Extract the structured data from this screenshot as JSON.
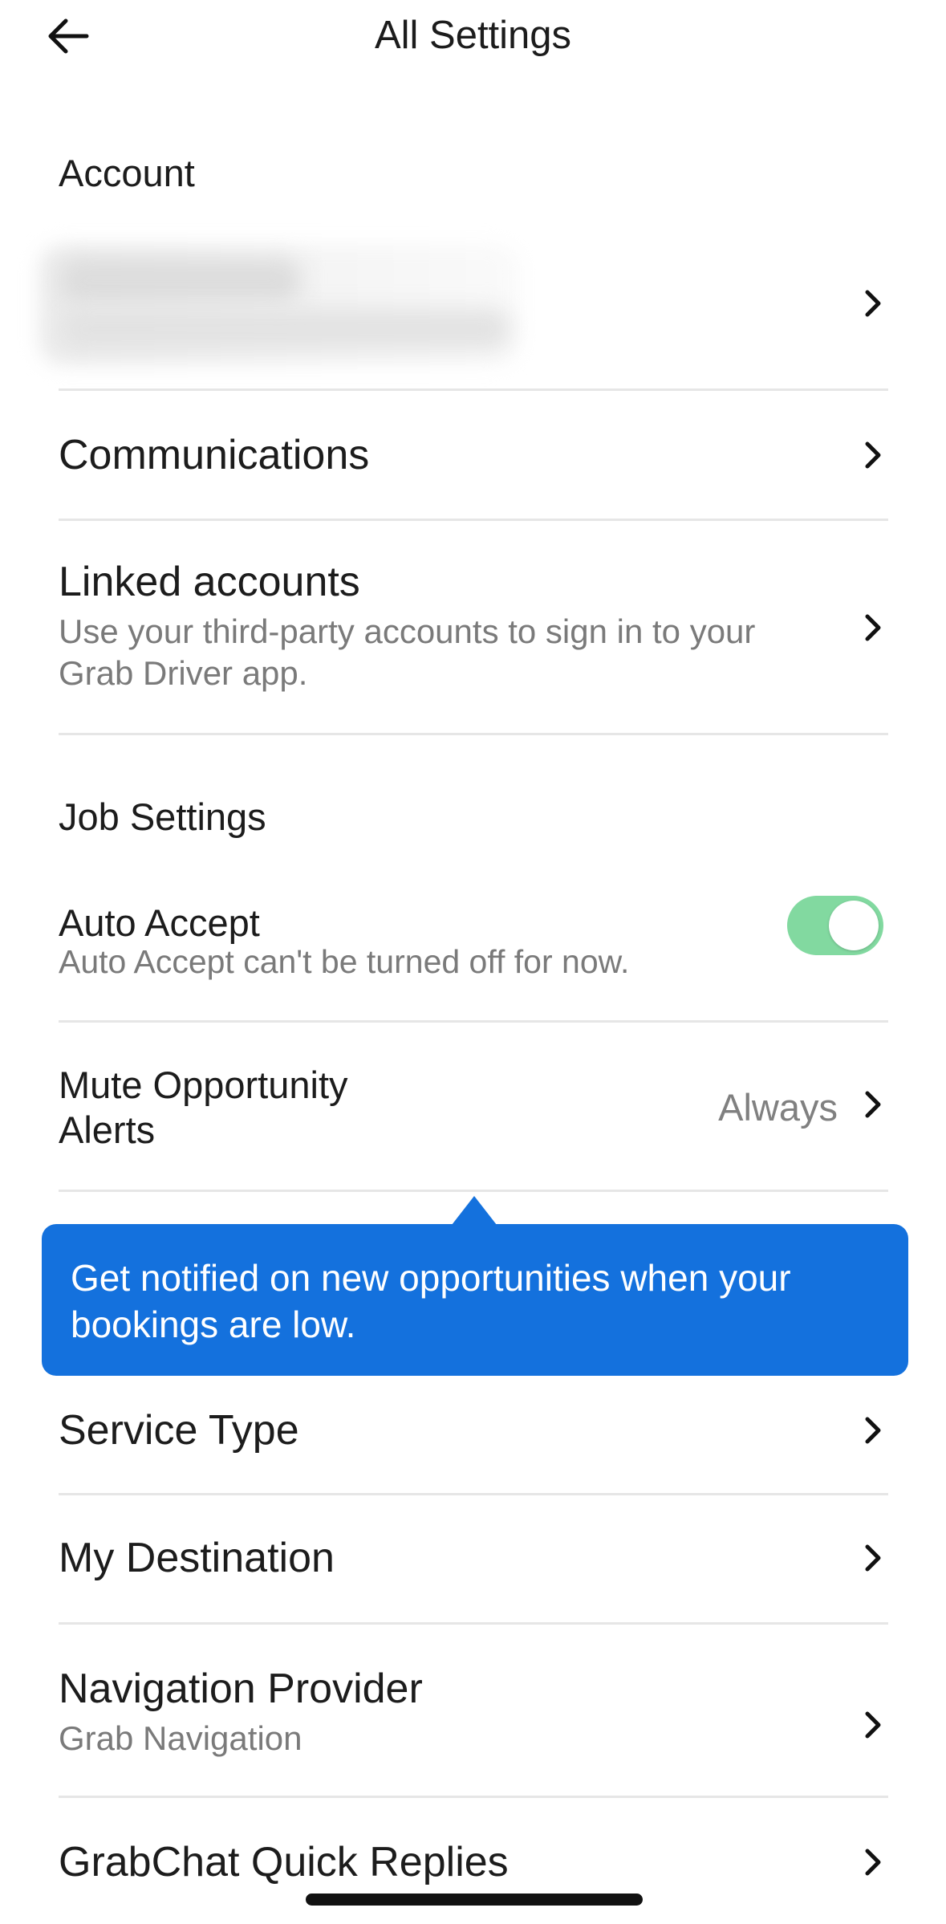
{
  "header": {
    "title": "All Settings",
    "back_icon": "arrow-left-icon"
  },
  "sections": {
    "account": "Account",
    "job_settings": "Job Settings"
  },
  "account": {
    "communications": "Communications",
    "linked_accounts": {
      "title": "Linked accounts",
      "subtitle": "Use your third-party accounts to sign in to your Grab Driver app."
    }
  },
  "job": {
    "auto_accept": {
      "title": "Auto Accept",
      "subtitle": "Auto Accept can't be turned off for now.",
      "enabled": true
    },
    "mute_alerts": {
      "title_line1": "Mute Opportunity",
      "title_line2": "Alerts",
      "value": "Always"
    },
    "tooltip": "Get notified on new opportunities when your bookings are low.",
    "service_type": "Service Type",
    "my_destination": "My Destination",
    "navigation_provider": {
      "title": "Navigation Provider",
      "subtitle": "Grab Navigation"
    },
    "quick_replies": "GrabChat Quick Replies"
  },
  "colors": {
    "toggle_on": "#82d9a0",
    "tooltip_bg": "#1471dd",
    "secondary_text": "#7a7a7a"
  }
}
